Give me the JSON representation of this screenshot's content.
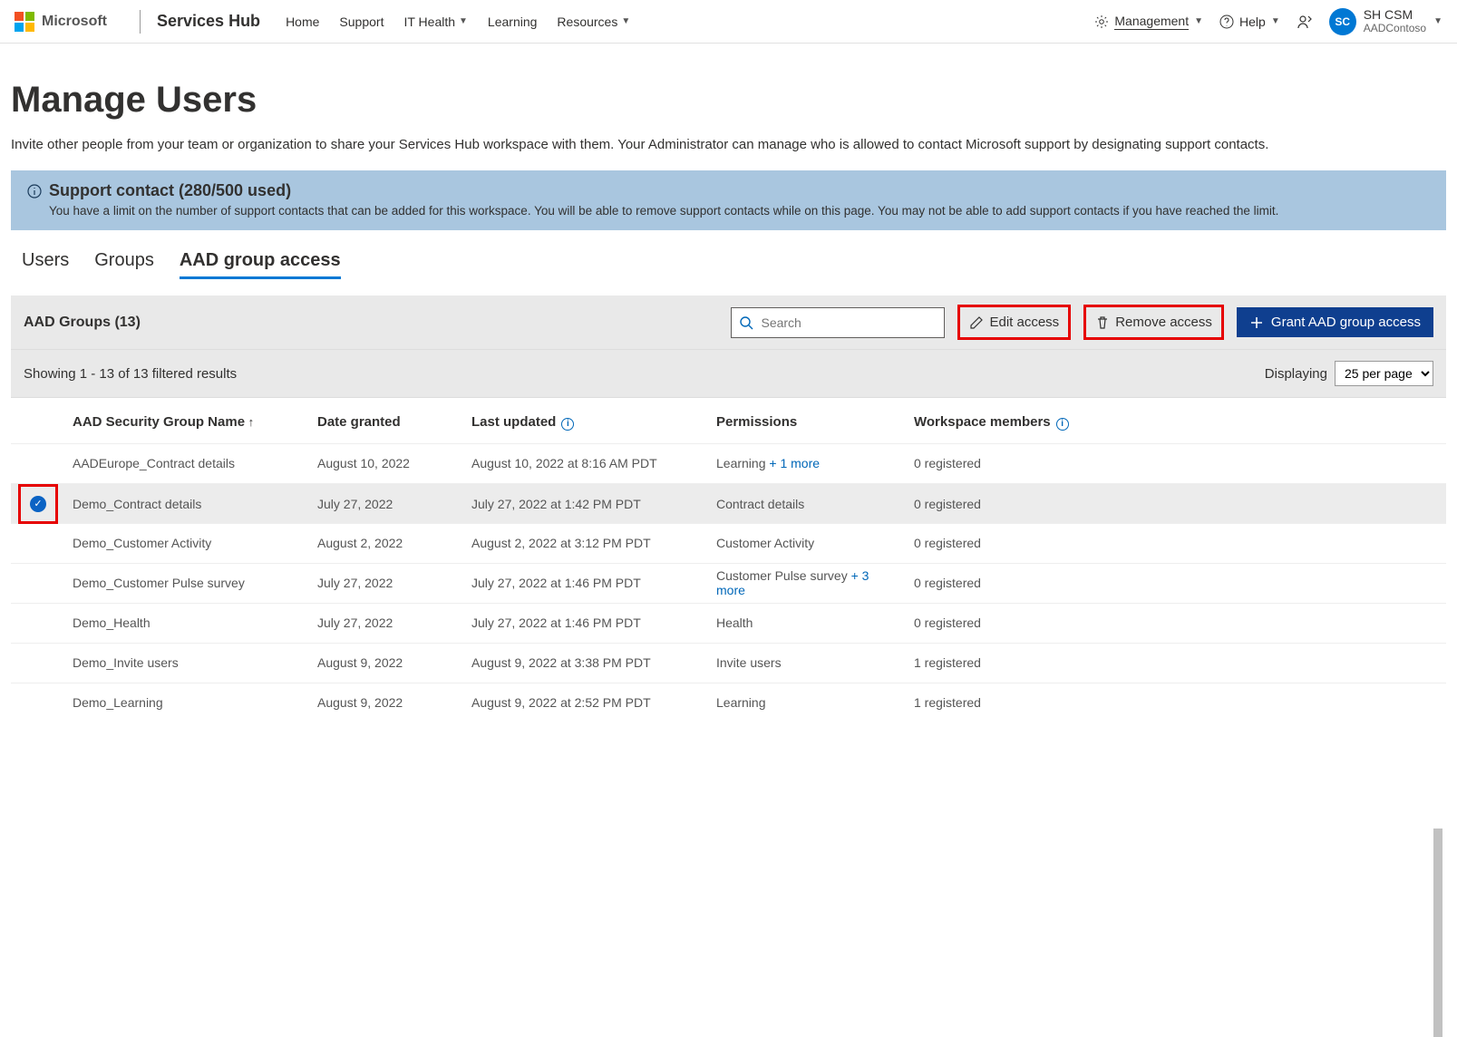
{
  "header": {
    "brand": "Microsoft",
    "product": "Services Hub",
    "nav": {
      "home": "Home",
      "support": "Support",
      "it": "IT Health",
      "learning": "Learning",
      "resources": "Resources"
    },
    "management": "Management",
    "help": "Help",
    "user_initials": "SC",
    "user_name": "SH CSM",
    "user_org": "AADContoso"
  },
  "page": {
    "title": "Manage Users",
    "subtitle": "Invite other people from your team or organization to share your Services Hub workspace with them. Your Administrator can manage who is allowed to contact Microsoft support by designating support contacts."
  },
  "notice": {
    "title": "Support contact (280/500 used)",
    "body": "You have a limit on the number of support contacts that can be added for this workspace. You will be able to remove support contacts while on this page. You may not be able to add support contacts if you have reached the limit."
  },
  "tabs": {
    "users": "Users",
    "groups": "Groups",
    "aad": "AAD group access"
  },
  "toolbar": {
    "left": "AAD Groups (13)",
    "search_placeholder": "Search",
    "edit": "Edit access",
    "remove": "Remove access",
    "grant": "Grant AAD group access"
  },
  "results": {
    "showing": "Showing 1 - 13 of 13 filtered results",
    "displaying": "Displaying",
    "per_page": "25 per page"
  },
  "columns": {
    "name": "AAD Security Group Name",
    "date": "Date granted",
    "updated": "Last updated",
    "perm": "Permissions",
    "members": "Workspace members"
  },
  "rows": [
    {
      "name": "AADEurope_Contract details",
      "date": "August 10, 2022",
      "updated": "August 10, 2022 at 8:16 AM PDT",
      "perm": "Learning",
      "perm_more": "+ 1 more",
      "members": "0 registered",
      "selected": false
    },
    {
      "name": "Demo_Contract details",
      "date": "July 27, 2022",
      "updated": "July 27, 2022 at 1:42 PM PDT",
      "perm": "Contract details",
      "perm_more": "",
      "members": "0 registered",
      "selected": true
    },
    {
      "name": "Demo_Customer Activity",
      "date": "August 2, 2022",
      "updated": "August 2, 2022 at 3:12 PM PDT",
      "perm": "Customer Activity",
      "perm_more": "",
      "members": "0 registered",
      "selected": false
    },
    {
      "name": "Demo_Customer Pulse survey",
      "date": "July 27, 2022",
      "updated": "July 27, 2022 at 1:46 PM PDT",
      "perm": "Customer Pulse survey",
      "perm_more": "+ 3 more",
      "members": "0 registered",
      "selected": false
    },
    {
      "name": "Demo_Health",
      "date": "July 27, 2022",
      "updated": "July 27, 2022 at 1:46 PM PDT",
      "perm": "Health",
      "perm_more": "",
      "members": "0 registered",
      "selected": false
    },
    {
      "name": "Demo_Invite users",
      "date": "August 9, 2022",
      "updated": "August 9, 2022 at 3:38 PM PDT",
      "perm": "Invite users",
      "perm_more": "",
      "members": "1 registered",
      "selected": false
    },
    {
      "name": "Demo_Learning",
      "date": "August 9, 2022",
      "updated": "August 9, 2022 at 2:52 PM PDT",
      "perm": "Learning",
      "perm_more": "",
      "members": "1 registered",
      "selected": false
    }
  ]
}
